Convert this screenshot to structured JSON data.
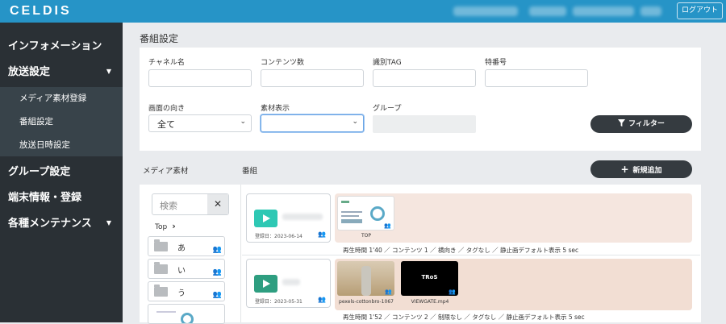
{
  "header": {
    "logo": "CELDIS",
    "logout_label": "ログアウト"
  },
  "sidebar": {
    "items": [
      {
        "label": "インフォメーション"
      },
      {
        "label": "放送設定",
        "caret": "▼"
      },
      {
        "label": "メディア素材登録"
      },
      {
        "label": "番組設定"
      },
      {
        "label": "放送日時設定"
      },
      {
        "label": "グループ設定"
      },
      {
        "label": "端末情報・登録"
      },
      {
        "label": "各種メンテナンス",
        "caret": "▼"
      }
    ]
  },
  "page": {
    "title": "番組設定"
  },
  "filters": {
    "channel_label": "チャネル名",
    "contents_label": "コンテンツ数",
    "tag_label": "識別TAG",
    "special_label": "特番号",
    "orientation_label": "画面の向き",
    "orientation_value": "全て",
    "material_label": "素材表示",
    "material_value": "",
    "group_label": "グループ",
    "filter_button": "フィルター"
  },
  "sections": {
    "media_label": "メディア素材",
    "program_label": "番組",
    "add_button": "新規追加"
  },
  "media": {
    "search_placeholder": "検索",
    "clear": "✕",
    "breadcrumb": "Top",
    "folders": [
      {
        "name": "あ"
      },
      {
        "name": "い"
      },
      {
        "name": "う"
      }
    ]
  },
  "programs": [
    {
      "date": "登録日：2023-06-14",
      "bg": "#f5e6df",
      "play_color": "#2ec8b4",
      "media": [
        {
          "caption": "TOP",
          "kind": "slide"
        }
      ],
      "info": "再生時間 1'40 ／ コンテンツ 1 ／ 横向き ／ タグなし ／ 静止画デフォルト表示 5 sec"
    },
    {
      "date": "登録日：2023-05-31",
      "bg": "#f2ded3",
      "play_color": "#2e9e80",
      "media": [
        {
          "caption": "pexels-cottonbro-1067",
          "kind": "photo"
        },
        {
          "caption": "VIEWGATE.mp4",
          "kind": "video",
          "text": "TRoS"
        }
      ],
      "info": "再生時間 1'52 ／ コンテンツ 2 ／ 制限なし ／ タグなし ／ 静止画デフォルト表示 5 sec"
    }
  ],
  "colors": {
    "accent": "#2694c7",
    "sidebar": "#2a3035",
    "group": "#3aa04a"
  }
}
